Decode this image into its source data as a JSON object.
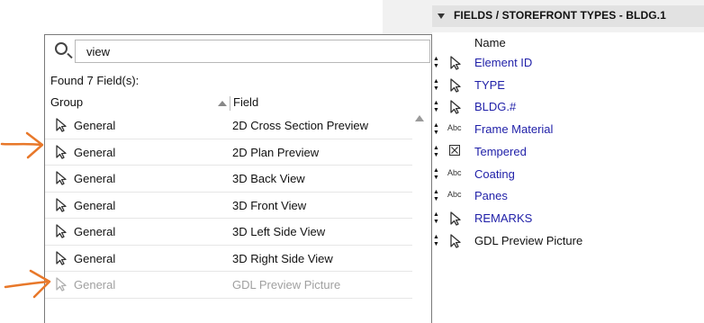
{
  "right_panel": {
    "header_title": "FIELDS /  STOREFRONT TYPES - BLDG.1",
    "column_header": "Name",
    "rows": [
      {
        "icon": "cursor-icon",
        "label": "Element ID",
        "color": "#1f1fa8"
      },
      {
        "icon": "cursor-icon",
        "label": "TYPE",
        "color": "#1f1fa8"
      },
      {
        "icon": "cursor-icon",
        "label": "BLDG.#",
        "color": "#1f1fa8"
      },
      {
        "icon": "abc-text-icon",
        "icon_text": "Abc",
        "label": "Frame Material",
        "color": "#1f1fa8"
      },
      {
        "icon": "checkbox-x-icon",
        "label": "Tempered",
        "color": "#1f1fa8"
      },
      {
        "icon": "abc-text-icon",
        "icon_text": "Abc",
        "label": "Coating",
        "color": "#1f1fa8"
      },
      {
        "icon": "abc-text-icon",
        "icon_text": "Abc",
        "label": "Panes",
        "color": "#1f1fa8"
      },
      {
        "icon": "cursor-icon",
        "label": "REMARKS",
        "color": "#1f1fa8"
      },
      {
        "icon": "cursor-icon",
        "label": "GDL Preview Picture",
        "color": "#111111"
      }
    ]
  },
  "dialog": {
    "search_value": "view",
    "found_text": "Found 7 Field(s):",
    "columns": {
      "group": "Group",
      "field": "Field"
    },
    "rows": [
      {
        "group": "General",
        "field": "2D Cross Section Preview",
        "disabled": false
      },
      {
        "group": "General",
        "field": "2D Plan Preview",
        "disabled": false
      },
      {
        "group": "General",
        "field": "3D Back View",
        "disabled": false
      },
      {
        "group": "General",
        "field": "3D Front View",
        "disabled": false
      },
      {
        "group": "General",
        "field": "3D Left Side View",
        "disabled": false
      },
      {
        "group": "General",
        "field": "3D Right Side View",
        "disabled": false
      },
      {
        "group": "General",
        "field": "GDL Preview Picture",
        "disabled": true
      }
    ]
  },
  "colors": {
    "link_blue": "#1f1fa8",
    "annotation_orange": "#e8782a",
    "disabled_gray": "#a0a0a0"
  }
}
